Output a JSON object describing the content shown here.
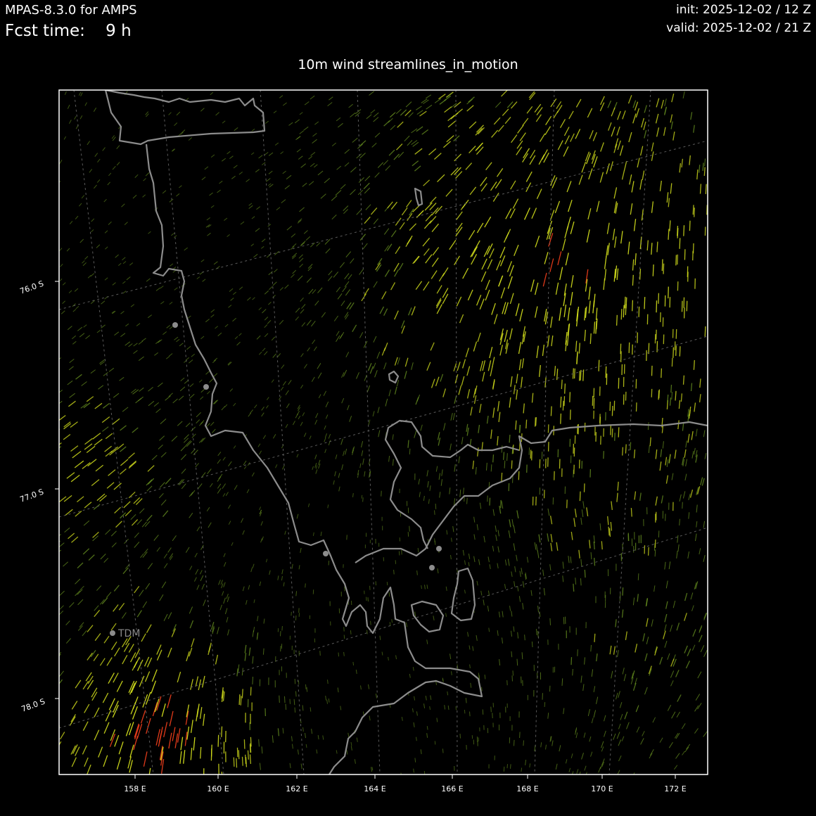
{
  "header": {
    "model": "MPAS-8.3.0 for AMPS",
    "fcst_label": "Fcst time:",
    "fcst_value": "9 h",
    "init": "init: 2025-12-02 / 12 Z",
    "valid": "valid: 2025-12-02 / 21 Z"
  },
  "map": {
    "title": "10m wind streamlines_in_motion",
    "lat_labels": [
      "76.0 S",
      "77.0 S",
      "78.0 S"
    ],
    "lon_labels": [
      "158 E",
      "160 E",
      "162 E",
      "164 E",
      "166 E",
      "168 E",
      "170 E",
      "172 E"
    ],
    "station_label": "TDM",
    "colors": {
      "background": "#000000",
      "coastline": "#8c8c8c",
      "graticule": "#5a5a5a",
      "frame": "#ffffff",
      "wind_low": "#6e9a22",
      "wind_mid": "#d4e01c",
      "wind_high": "#e03a1a"
    }
  }
}
